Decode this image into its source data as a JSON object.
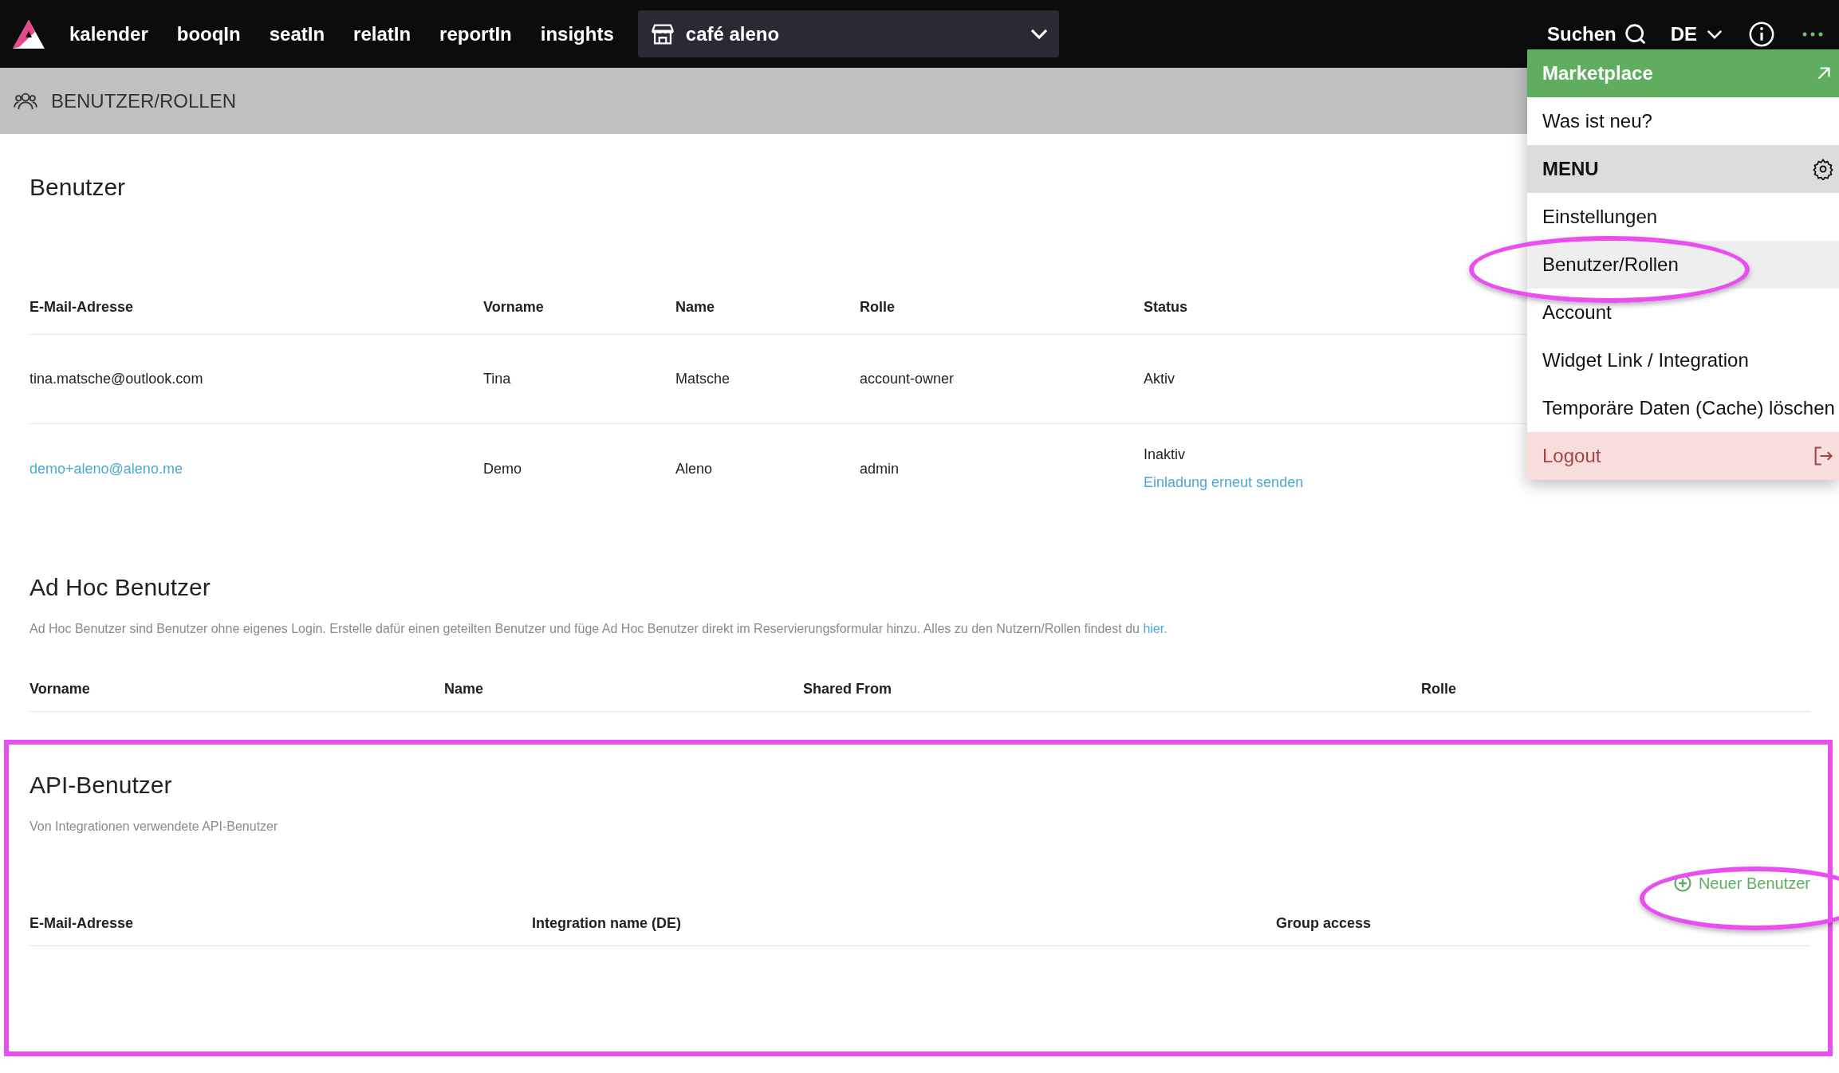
{
  "topbar": {
    "nav": [
      {
        "label": "kalender"
      },
      {
        "label": "booqIn"
      },
      {
        "label": "seatIn"
      },
      {
        "label": "relatIn"
      },
      {
        "label": "reportIn"
      },
      {
        "label": "insights"
      }
    ],
    "venue": "café aleno",
    "search": "Suchen",
    "language": "DE"
  },
  "breadcrumb": "BENUTZER/ROLLEN",
  "menu": [
    {
      "kind": "external",
      "label": "Marketplace",
      "selected": false
    },
    {
      "kind": "item",
      "label": "Was ist neu?",
      "selected": false
    },
    {
      "kind": "header",
      "label": "MENU",
      "selected": false
    },
    {
      "kind": "item",
      "label": "Einstellungen",
      "selected": false
    },
    {
      "kind": "item",
      "label": "Benutzer/Rollen",
      "selected": true
    },
    {
      "kind": "item",
      "label": "Account",
      "selected": false
    },
    {
      "kind": "item",
      "label": "Widget Link / Integration",
      "selected": false
    },
    {
      "kind": "item",
      "label": "Temporäre Daten (Cache) löschen",
      "selected": false
    },
    {
      "kind": "logout",
      "label": "Logout",
      "selected": false
    }
  ],
  "users": {
    "title": "Benutzer",
    "columns": [
      "E-Mail-Adresse",
      "Vorname",
      "Name",
      "Rolle",
      "Status"
    ],
    "rows": [
      {
        "email": "tina.matsche@outlook.com",
        "email_link": false,
        "first": "Tina",
        "last": "Matsche",
        "role": "account-owner",
        "status": "Aktiv"
      },
      {
        "email": "demo+aleno@aleno.me",
        "email_link": true,
        "first": "Demo",
        "last": "Aleno",
        "role": "admin",
        "status": "Inaktiv",
        "action": "Einladung erneut senden"
      }
    ]
  },
  "adhoc": {
    "title": "Ad Hoc Benutzer",
    "description": "Ad Hoc Benutzer sind Benutzer ohne eigenes Login. Erstelle dafür einen geteilten Benutzer und füge Ad Hoc Benutzer direkt im Reservierungsformular hinzu. Alles zu den Nutzern/Rollen findest du",
    "link": "hier.",
    "columns": [
      "Vorname",
      "Name",
      "Shared From",
      "Rolle"
    ]
  },
  "api": {
    "title": "API-Benutzer",
    "description": "Von Integrationen verwendete API-Benutzer",
    "new_button": "Neuer Benutzer",
    "columns": [
      "E-Mail-Adresse",
      "Integration name (DE)",
      "Group access"
    ]
  }
}
